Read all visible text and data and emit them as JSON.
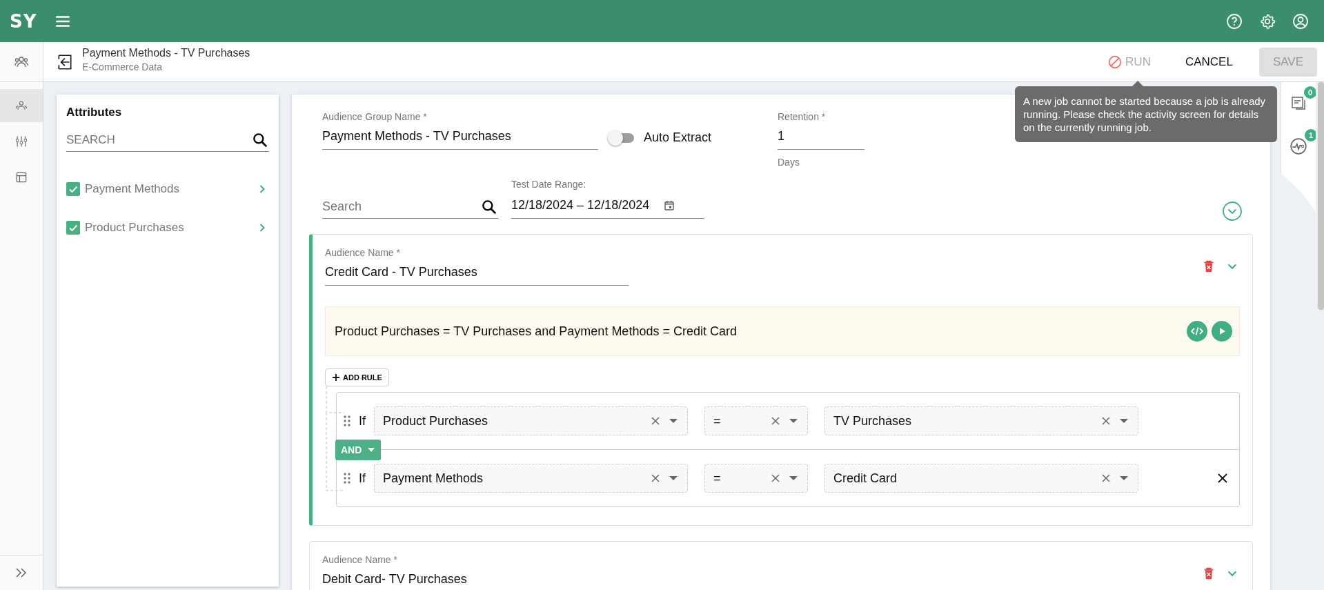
{
  "app": {
    "logo": "SY"
  },
  "header": {
    "title": "Payment Methods - TV Purchases",
    "subtitle": "E-Commerce Data"
  },
  "actions": {
    "run": {
      "label": "RUN",
      "disabled": true
    },
    "cancel": {
      "label": "CANCEL"
    },
    "save": {
      "label": "SAVE",
      "disabled": true
    }
  },
  "tooltip": {
    "text": "A new job cannot be started because a job is already running. Please check the activity screen for details on the currently running job."
  },
  "side_nav": [
    {
      "kind": "sliders",
      "selected": false
    },
    {
      "kind": "layout",
      "selected": false
    }
  ],
  "side_nav_active": {
    "selected": true
  },
  "right_panel": [
    {
      "kind": "notes",
      "badge": "0"
    },
    {
      "kind": "activity",
      "badge": "1"
    }
  ],
  "attributes": {
    "title": "Attributes",
    "search": {
      "placeholder": "SEARCH"
    },
    "items": [
      {
        "label": "Payment Methods",
        "checked": true
      },
      {
        "label": "Product Purchases",
        "checked": true
      }
    ]
  },
  "form": {
    "group_name": {
      "label": "Audience Group Name *",
      "value": "Payment Methods - TV Purchases"
    },
    "auto_extract": {
      "label": "Auto Extract",
      "on": false
    },
    "retention": {
      "label": "Retention *",
      "value": "1",
      "hint": "Days"
    },
    "search": {
      "placeholder": "Search"
    },
    "date_range": {
      "label": "Test Date Range:",
      "value": "12/18/2024 – 12/18/2024"
    }
  },
  "audiences": [
    {
      "label": "Audience Name *",
      "name": "Credit Card - TV Purchases",
      "expanded": true,
      "summary": "Product Purchases = TV Purchases and Payment Methods = Credit Card",
      "add_rule": "ADD RULE",
      "connector": "AND",
      "rules": [
        {
          "prefix": "If",
          "field": "Product Purchases",
          "operator": "=",
          "value": "TV Purchases",
          "removable": false
        },
        {
          "prefix": "If",
          "field": "Payment Methods",
          "operator": "=",
          "value": "Credit Card",
          "removable": true
        }
      ]
    },
    {
      "label": "Audience Name *",
      "name": "Debit Card- TV Purchases",
      "expanded": false
    }
  ]
}
